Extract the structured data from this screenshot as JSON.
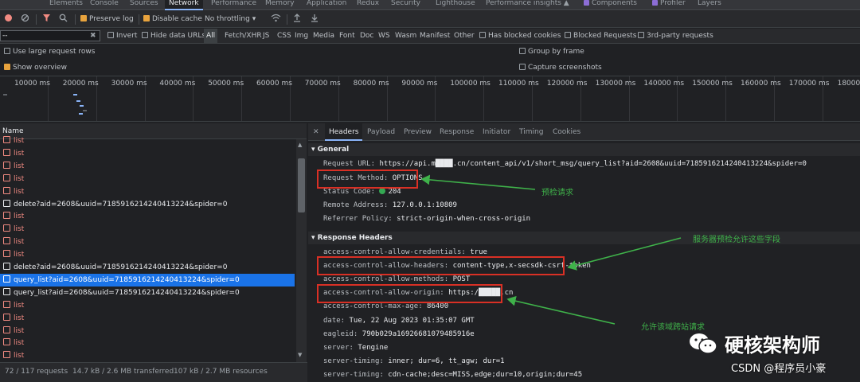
{
  "tabs": [
    {
      "label": "Elements"
    },
    {
      "label": "Console"
    },
    {
      "label": "Sources"
    },
    {
      "label": "Network"
    },
    {
      "label": "Performance"
    },
    {
      "label": "Memory"
    },
    {
      "label": "Application"
    },
    {
      "label": "Redux"
    },
    {
      "label": "Security"
    },
    {
      "label": "Lighthouse"
    },
    {
      "label": "Performance insights"
    },
    {
      "label": "Components"
    },
    {
      "label": "Profiler"
    },
    {
      "label": "Layers"
    }
  ],
  "toolbar": {
    "preserve_log": "Preserve log",
    "disable_cache": "Disable cache",
    "throttling": "No throttling"
  },
  "filter": {
    "value": "--",
    "invert": "Invert",
    "hide_data_urls": "Hide data URLs",
    "types": [
      "All",
      "Fetch/XHR",
      "JS",
      "CSS",
      "Img",
      "Media",
      "Font",
      "Doc",
      "WS",
      "Wasm",
      "Manifest",
      "Other"
    ],
    "has_blocked_cookies": "Has blocked cookies",
    "blocked_requests": "Blocked Requests",
    "third_party": "3rd-party requests"
  },
  "options": {
    "large_rows": "Use large request rows",
    "show_overview": "Show overview",
    "group_by_frame": "Group by frame",
    "capture_screenshots": "Capture screenshots"
  },
  "timeline": {
    "ticks": [
      "10000 ms",
      "20000 ms",
      "30000 ms",
      "40000 ms",
      "50000 ms",
      "60000 ms",
      "70000 ms",
      "80000 ms",
      "90000 ms",
      "100000 ms",
      "110000 ms",
      "120000 ms",
      "130000 ms",
      "140000 ms",
      "150000 ms",
      "160000 ms",
      "170000 ms",
      "180000 m"
    ]
  },
  "requests": {
    "header": "Name",
    "rows": [
      {
        "name": "list",
        "kind": "err"
      },
      {
        "name": "list",
        "kind": "err"
      },
      {
        "name": "list",
        "kind": "err"
      },
      {
        "name": "list",
        "kind": "err"
      },
      {
        "name": "list",
        "kind": "err"
      },
      {
        "name": "delete?aid=2608&uuid=7185916214240413224&spider=0",
        "kind": "ok"
      },
      {
        "name": "list",
        "kind": "err"
      },
      {
        "name": "list",
        "kind": "err"
      },
      {
        "name": "list",
        "kind": "err"
      },
      {
        "name": "list",
        "kind": "err"
      },
      {
        "name": "delete?aid=2608&uuid=7185916214240413224&spider=0",
        "kind": "ok"
      },
      {
        "name": "query_list?aid=2608&uuid=7185916214240413224&spider=0",
        "kind": "sel"
      },
      {
        "name": "query_list?aid=2608&uuid=7185916214240413224&spider=0",
        "kind": "ok"
      },
      {
        "name": "list",
        "kind": "err"
      },
      {
        "name": "list",
        "kind": "err"
      },
      {
        "name": "list",
        "kind": "err"
      },
      {
        "name": "list",
        "kind": "err"
      },
      {
        "name": "list",
        "kind": "err"
      }
    ]
  },
  "status": {
    "requests": "72 / 117 requests",
    "transferred": "14.7 kB / 2.6 MB transferred",
    "resources": "107 kB / 2.7 MB resources"
  },
  "detail": {
    "tabs": [
      "Headers",
      "Payload",
      "Preview",
      "Response",
      "Initiator",
      "Timing",
      "Cookies"
    ],
    "general_title": "General",
    "general": [
      {
        "key": "Request URL:",
        "value": "https://api.m████.cn/content_api/v1/short_msg/query_list?aid=2608&uuid=7185916214240413224&spider=0"
      },
      {
        "key": "Request Method:",
        "value": "OPTIONS"
      },
      {
        "key": "Status Code:",
        "value": "204"
      },
      {
        "key": "Remote Address:",
        "value": "127.0.0.1:10809"
      },
      {
        "key": "Referrer Policy:",
        "value": "strict-origin-when-cross-origin"
      }
    ],
    "response_title": "Response Headers",
    "response": [
      {
        "key": "access-control-allow-credentials:",
        "value": "true"
      },
      {
        "key": "access-control-allow-headers:",
        "value": "content-type,x-secsdk-csrf-token"
      },
      {
        "key": "access-control-allow-methods:",
        "value": "POST"
      },
      {
        "key": "access-control-allow-origin:",
        "value": "https:/█████.cn"
      },
      {
        "key": "access-control-max-age:",
        "value": "86400"
      },
      {
        "key": "date:",
        "value": "Tue, 22 Aug 2023 01:35:07 GMT"
      },
      {
        "key": "eagleid:",
        "value": "790b029a16926681079485916e"
      },
      {
        "key": "server:",
        "value": "Tengine"
      },
      {
        "key": "server-timing:",
        "value": "inner; dur=6, tt_agw; dur=1"
      },
      {
        "key": "server-timing:",
        "value": "cdn-cache;desc=MISS,edge;dur=10,origin;dur=45"
      }
    ]
  },
  "annotations": {
    "preflight": "预检请求",
    "allowed_fields": "服务器预检允许这些字段",
    "allow_domain": "允许该域跨站请求"
  },
  "watermark": {
    "brand": "硬核架构师",
    "csdn": "CSDN @程序员小豪"
  },
  "colors": {
    "panel_bg": "#202124",
    "selected_row": "#1a73e8",
    "error_text": "#f28b82",
    "annotation_green": "#3fb24a",
    "box_red": "#d93025",
    "accent_orange": "#e8a33d"
  }
}
